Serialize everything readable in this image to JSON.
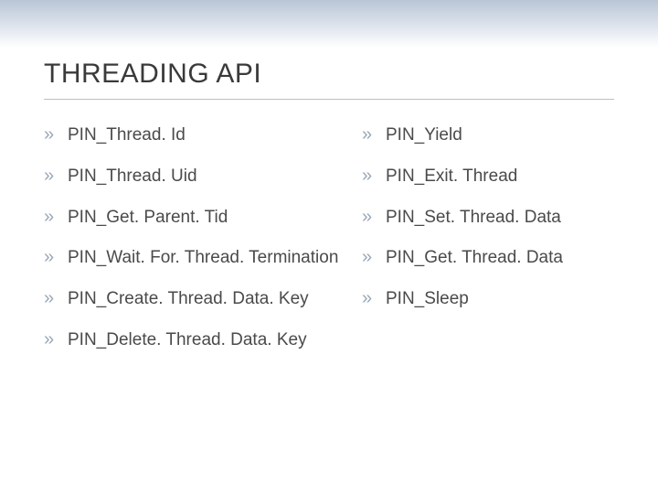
{
  "title": "THREADING API",
  "bullet": "»",
  "left_items": [
    "PIN_Thread. Id",
    "PIN_Thread. Uid",
    "PIN_Get. Parent. Tid",
    "PIN_Wait. For. Thread. Termination",
    "PIN_Create. Thread. Data. Key",
    "PIN_Delete. Thread. Data. Key"
  ],
  "right_items": [
    "PIN_Yield",
    "PIN_Exit. Thread",
    "PIN_Set. Thread. Data",
    "PIN_Get. Thread. Data",
    "PIN_Sleep"
  ]
}
